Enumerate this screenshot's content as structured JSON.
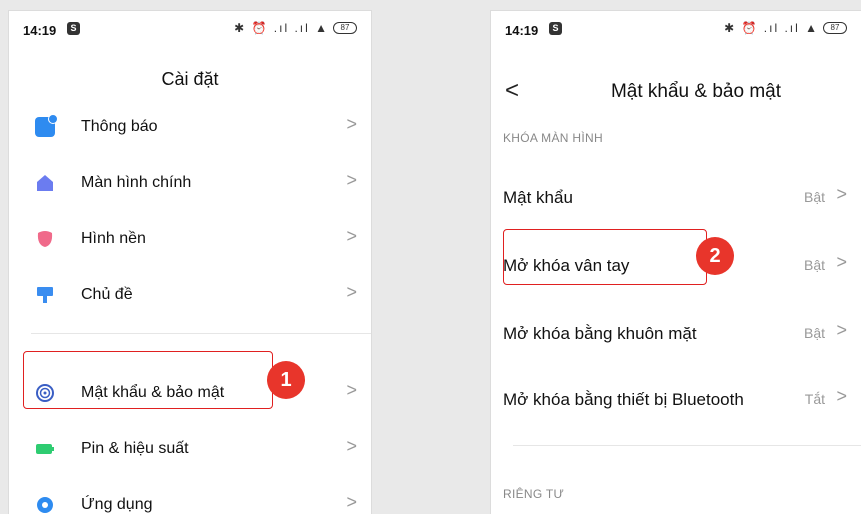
{
  "left": {
    "status": {
      "time": "14:19",
      "sim": "S",
      "icons": "✱ ⏰ .ıl .ıl ▲",
      "battery": "87"
    },
    "title": "Cài đặt",
    "items": [
      {
        "label": "Thông báo",
        "icon": "notification-icon"
      },
      {
        "label": "Màn hình chính",
        "icon": "home-icon"
      },
      {
        "label": "Hình nền",
        "icon": "wallpaper-icon"
      },
      {
        "label": "Chủ đề",
        "icon": "theme-icon"
      },
      {
        "label": "Mật khẩu & bảo mật",
        "icon": "fingerprint-icon"
      },
      {
        "label": "Pin & hiệu suất",
        "icon": "battery-icon"
      },
      {
        "label": "Ứng dụng",
        "icon": "apps-icon"
      }
    ],
    "step": "1"
  },
  "right": {
    "status": {
      "time": "14:19",
      "sim": "S",
      "icons": "✱ ⏰ .ıl .ıl ▲",
      "battery": "87"
    },
    "title": "Mật khẩu & bảo mật",
    "section1": "KHÓA MÀN HÌNH",
    "items": [
      {
        "label": "Mật khẩu",
        "value": "Bật"
      },
      {
        "label": "Mở khóa vân tay",
        "value": "Bật"
      },
      {
        "label": "Mở khóa bằng khuôn mặt",
        "value": "Bật"
      },
      {
        "label": "Mở khóa bằng thiết bị Bluetooth",
        "value": "Tắt"
      }
    ],
    "section2": "RIÊNG TƯ",
    "step": "2"
  },
  "chevron": ">",
  "back": "<",
  "colors": {
    "highlight": "#e02020",
    "step": "#e8352b"
  }
}
